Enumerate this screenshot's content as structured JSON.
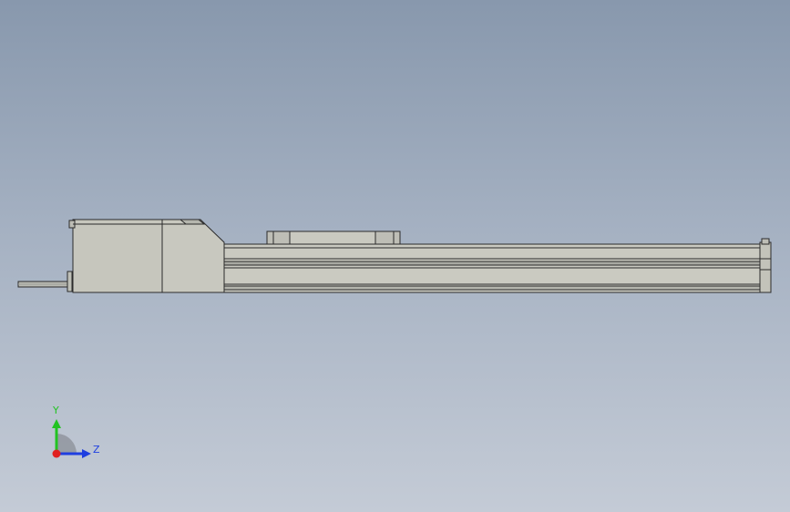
{
  "viewport": {
    "background_top": "#8898ad",
    "background_bottom": "#c4cbd6"
  },
  "model": {
    "body_color": "#c9c9c0",
    "edge_color": "#2b2b2b",
    "parts": [
      "motor",
      "motor-cover",
      "cable",
      "rail",
      "carriage",
      "end-cap"
    ]
  },
  "triad": {
    "y_label": "Y",
    "z_label": "Z",
    "y_color": "#22c322",
    "z_color": "#1f3fe0",
    "x_color": "#e02020"
  }
}
